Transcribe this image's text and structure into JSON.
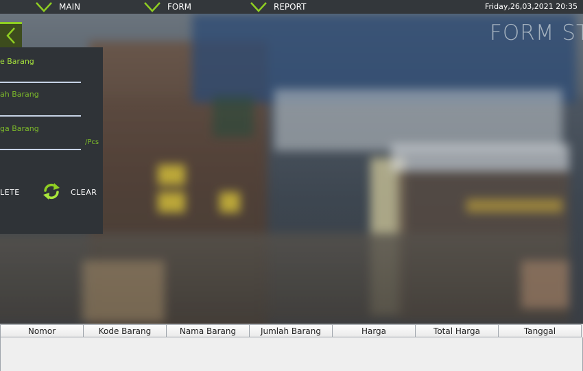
{
  "nav": {
    "items": [
      {
        "label": "MAIN",
        "icon": "chevron-down-icon"
      },
      {
        "label": "FORM",
        "icon": "chevron-down-icon"
      },
      {
        "label": "REPORT",
        "icon": "chevron-down-icon"
      }
    ],
    "datetime": "Friday,26,03,2021 20:35"
  },
  "page_title": "FORM ST",
  "form": {
    "kode_label": "e Barang",
    "nama_label": "ah Barang",
    "harga_label": "ga Barang",
    "unit": "/Pcs",
    "delete_label": "LETE",
    "clear_label": "CLEAR"
  },
  "table": {
    "columns": [
      "Nomor",
      "Kode Barang",
      "Nama Barang",
      "Jumlah Barang",
      "Harga",
      "Total Harga",
      "Tanggal"
    ],
    "rows": []
  },
  "colors": {
    "accent": "#8fce22",
    "label_green": "#7dbb2a",
    "topbar": "#33373b",
    "panel": "#2f3337"
  }
}
